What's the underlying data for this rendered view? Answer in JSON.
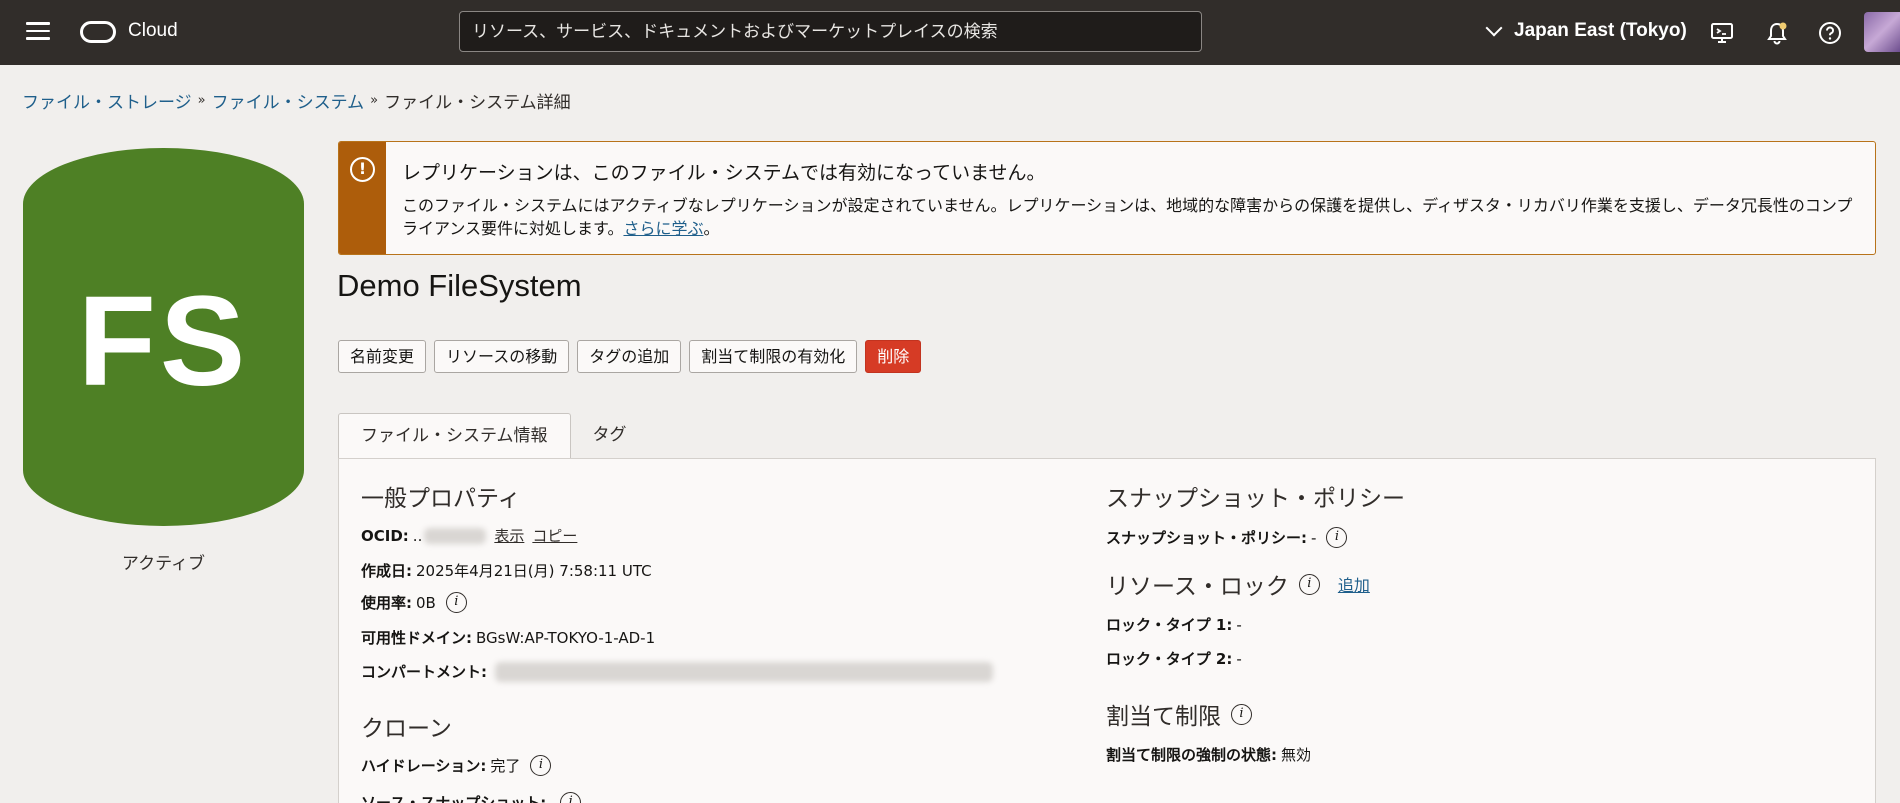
{
  "topbar": {
    "brand": "Cloud",
    "search_placeholder": "リソース、サービス、ドキュメントおよびマーケットプレイスの検索",
    "region": "Japan East (Tokyo)",
    "icons": [
      "menu-icon",
      "oracle-logo",
      "cloud-shell-icon",
      "notification-bell-icon",
      "help-icon",
      "user-avatar"
    ]
  },
  "breadcrumb": {
    "item1": "ファイル・ストレージ",
    "item2": "ファイル・システム",
    "current": "ファイル・システム詳細",
    "sep": "»"
  },
  "badge": {
    "initials": "FS",
    "status": "アクティブ",
    "color": "#4e8025"
  },
  "alert": {
    "title": "レプリケーションは、このファイル・システムでは有効になっていません。",
    "body": "このファイル・システムにはアクティブなレプリケーションが設定されていません。レプリケーションは、地域的な障害からの保護を提供し、ディザスタ・リカバリ作業を支援し、データ冗長性のコンプライアンス要件に対処します。",
    "link": "さらに学ぶ",
    "end": "。",
    "accent": "#ad5d0b"
  },
  "title": "Demo FileSystem",
  "actions": {
    "rename": "名前変更",
    "move": "リソースの移動",
    "add_tags": "タグの追加",
    "enable_quota": "割当て制限の有効化",
    "delete": "削除"
  },
  "tabs": {
    "info": "ファイル・システム情報",
    "tags": "タグ"
  },
  "general": {
    "heading": "一般プロパティ",
    "ocid_label": "OCID:",
    "ocid_prefix": "..",
    "ocid_show": "表示",
    "ocid_copy": "コピー",
    "created_label": "作成日:",
    "created_value": "2025年4月21日(月) 7:58:11 UTC",
    "usage_label": "使用率:",
    "usage_value": "0B",
    "ad_label": "可用性ドメイン:",
    "ad_value": "BGsW:AP-TOKYO-1-AD-1",
    "compartment_label": "コンパートメント:"
  },
  "clone": {
    "heading": "クローン",
    "hydration_label": "ハイドレーション:",
    "hydration_value": "完了",
    "source_label": "ソース・スナップショット:"
  },
  "snapshot": {
    "heading": "スナップショット・ポリシー",
    "policy_label": "スナップショット・ポリシー:",
    "policy_value": "-"
  },
  "lock": {
    "heading": "リソース・ロック",
    "add": "追加",
    "type1_label": "ロック・タイプ 1:",
    "type1_value": "-",
    "type2_label": "ロック・タイプ 2:",
    "type2_value": "-"
  },
  "quota": {
    "heading": "割当て制限",
    "enforce_label": "割当て制限の強制の状態:",
    "enforce_value": "無効"
  }
}
